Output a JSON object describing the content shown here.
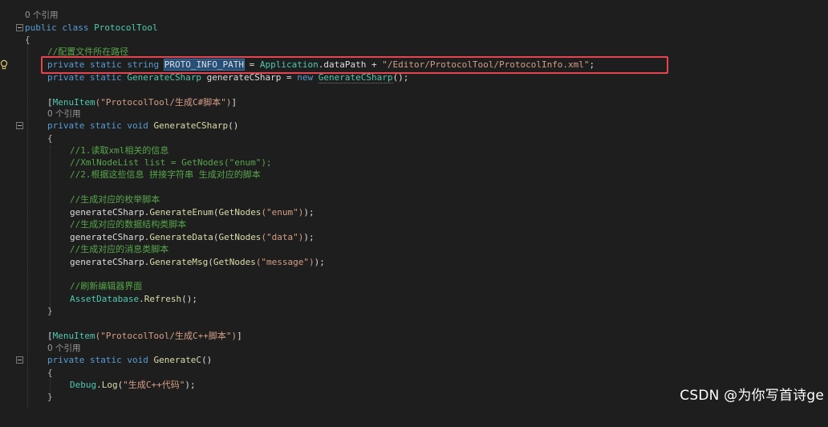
{
  "references": {
    "class_refs": "0 个引用",
    "method1_refs": "0 个引用",
    "method2_refs": "0 个引用"
  },
  "code": {
    "l_class_kw": "public class ",
    "l_class_name": "ProtocolTool",
    "l_open1": "{",
    "l_comment_path": "//配置文件所在路径",
    "l_field1_kw": "private static string ",
    "l_field1_name": "PROTO_INFO_PATH",
    "l_field1_eq": " = ",
    "l_field1_app": "Application",
    "l_field1_rest": ".dataPath + ",
    "l_field1_str": "\"/Editor/ProtocolTool/ProtocolInfo.xml\"",
    "l_field1_end": ";",
    "l_field2_kw": "private static ",
    "l_field2_type": "GenerateCSharp",
    "l_field2_name": " generateCSharp = ",
    "l_field2_new": "new ",
    "l_field2_ctor": "GenerateCSharp",
    "l_field2_end": "();",
    "l_attr1_open": "[",
    "l_attr1_name": "MenuItem",
    "l_attr1_str": "(\"ProtocolTool/生成C#脚本\")",
    "l_attr1_close": "]",
    "l_m1_kw": "private static void ",
    "l_m1_name": "GenerateCSharp",
    "l_m1_paren": "()",
    "l_open2": "{",
    "l_c1": "//1.读取xml相关的信息",
    "l_c2": "//XmlNodeList list = GetNodes(\"enum\");",
    "l_c3": "//2.根据这些信息 拼接字符串 生成对应的脚本",
    "l_c4": "//生成对应的枚举脚本",
    "l_call1_obj": "generateCSharp.",
    "l_call1_m": "GenerateEnum",
    "l_call1_p": "(",
    "l_call1_g": "GetNodes",
    "l_call1_s": "(\"enum\")",
    "l_call1_e": ");",
    "l_c5": "//生成对应的数据结构类脚本",
    "l_call2_m": "GenerateData",
    "l_call2_s": "(\"data\")",
    "l_c6": "//生成对应的消息类脚本",
    "l_call3_m": "GenerateMsg",
    "l_call3_s": "(\"message\")",
    "l_c7": "//刷新编辑器界面",
    "l_ref_type": "AssetDatabase",
    "l_ref_dot": ".",
    "l_ref_m": "Refresh",
    "l_ref_end": "();",
    "l_close2": "}",
    "l_attr2_str": "(\"ProtocolTool/生成C++脚本\")",
    "l_m2_name": "GenerateC",
    "l_open3": "{",
    "l_dbg_type": "Debug",
    "l_dbg_dot": ".",
    "l_dbg_m": "Log",
    "l_dbg_p": "(",
    "l_dbg_s": "\"生成C++代码\"",
    "l_dbg_e": ");",
    "l_close3": "}"
  },
  "watermark": "CSDN @为你写首诗ge",
  "colors": {
    "background": "#1e1e1e",
    "keyword": "#569cd6",
    "type": "#4ec9b0",
    "method": "#dcdcaa",
    "string": "#d69d85",
    "comment": "#57a64a",
    "highlight_box": "#e8434f"
  }
}
